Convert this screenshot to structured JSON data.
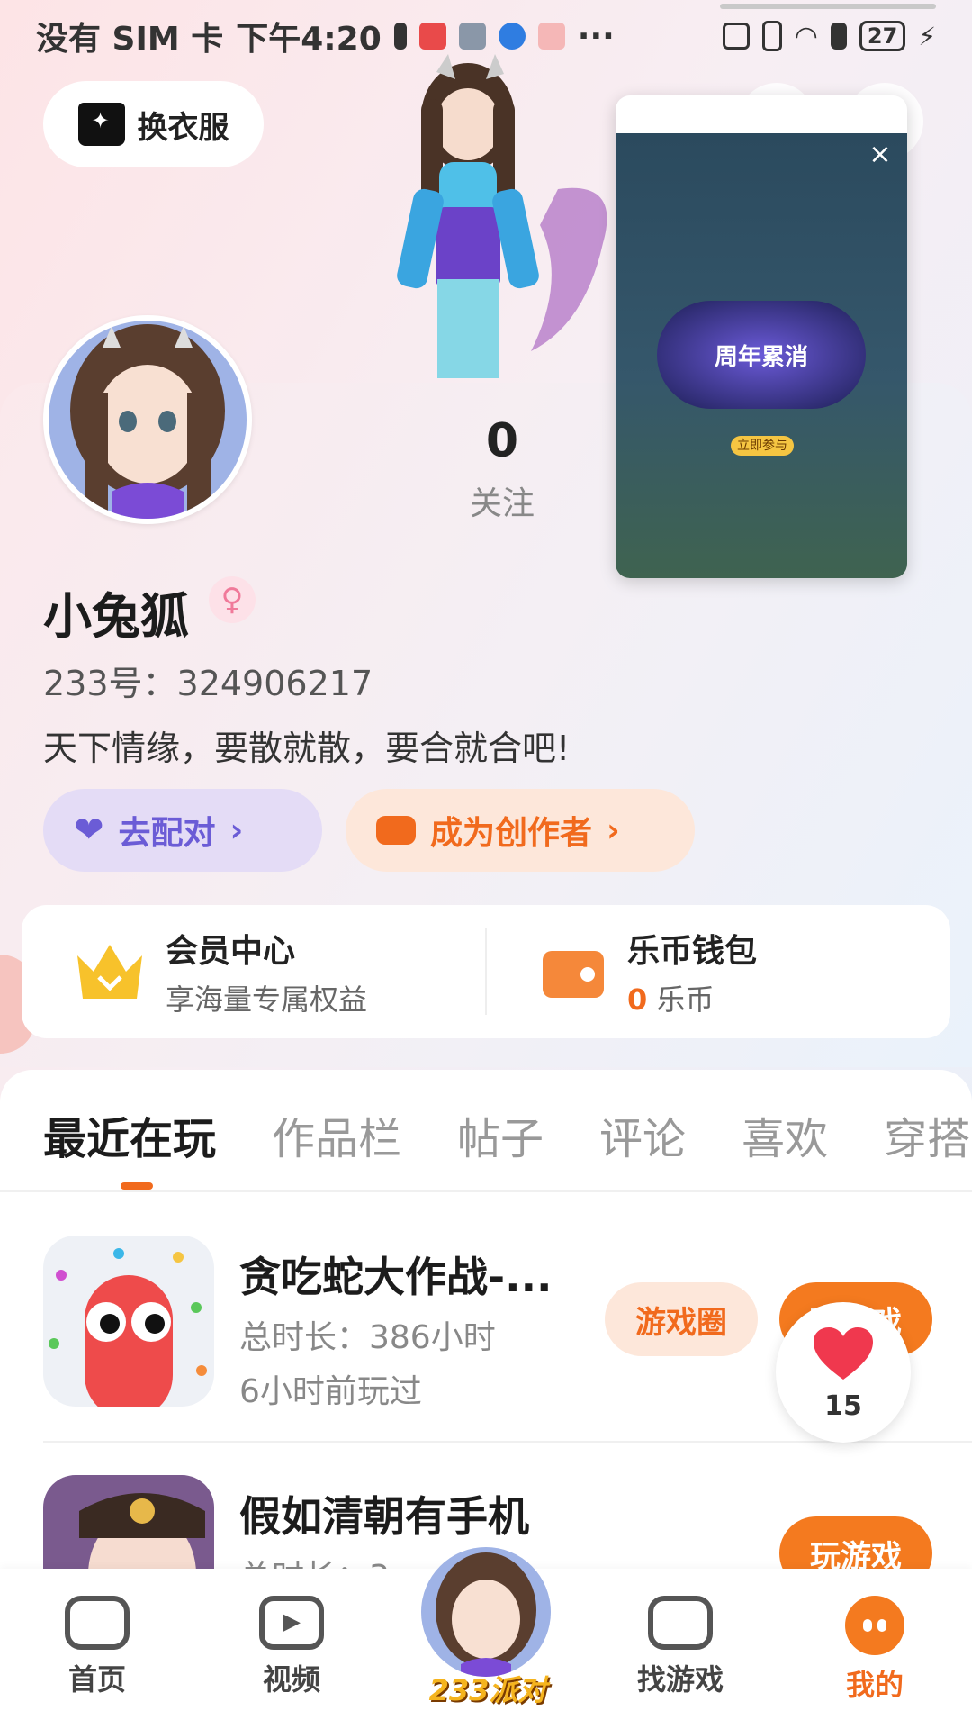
{
  "statusbar": {
    "carrier": "没有 SIM 卡",
    "time": "下午4:20",
    "more": "···",
    "battery": "27"
  },
  "header": {
    "dress_label": "换衣服"
  },
  "stats": {
    "following_count": "0",
    "following_label": "关注"
  },
  "profile": {
    "username": "小兔狐",
    "gender_symbol": "♀",
    "id_line": "233号：324906217",
    "bio": "天下情缘，要散就散，要合就合吧!"
  },
  "actions": {
    "match_label": "去配对",
    "creator_label": "成为创作者",
    "chevron": "›"
  },
  "vip": {
    "member_title": "会员中心",
    "member_sub": "享海量专属权益",
    "wallet_title": "乐币钱包",
    "wallet_amount": "0",
    "wallet_unit": "乐币"
  },
  "tabs": [
    "最近在玩",
    "作品栏",
    "帖子",
    "评论",
    "喜欢",
    "穿搭"
  ],
  "games": [
    {
      "title": "贪吃蛇大作战-...",
      "duration": "总时长：386小时",
      "last_played": "6小时前玩过",
      "circle_label": "游戏圈",
      "play_label": "玩游戏"
    },
    {
      "title": "假如清朝有手机",
      "duration": "总时长：3",
      "play_label": "玩游戏"
    }
  ],
  "like_bubble": {
    "count": "15"
  },
  "popup": {
    "close": "×",
    "banner_title": "周年累消",
    "banner_button": "立即参与"
  },
  "bottomnav": {
    "home": "首页",
    "video": "视频",
    "center": "233派对",
    "find": "找游戏",
    "me": "我的"
  },
  "colors": {
    "accent": "#f16a1d",
    "purple": "#6b5cd6",
    "play": "#f47a1f"
  }
}
